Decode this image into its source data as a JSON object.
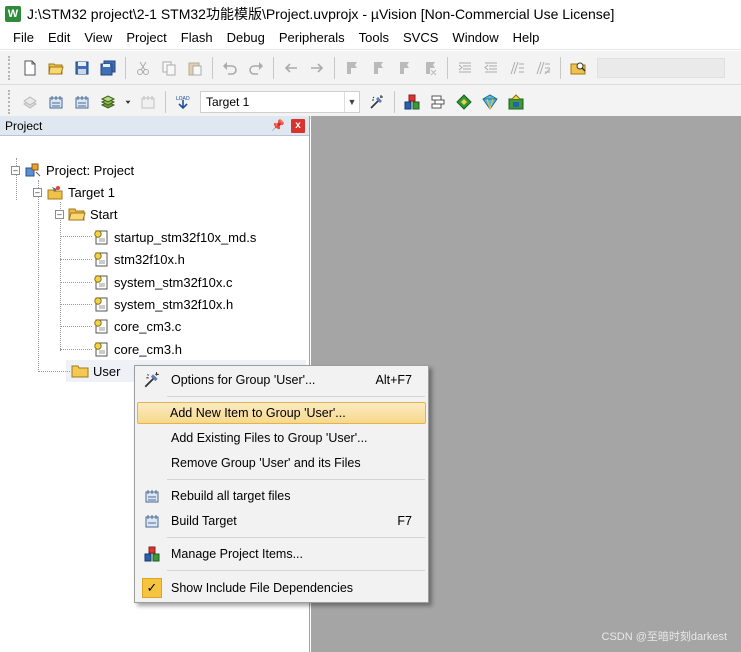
{
  "window": {
    "title": "J:\\STM32 project\\2-1 STM32功能模版\\Project.uvprojx - µVision  [Non-Commercial Use License]",
    "app_icon": "W"
  },
  "menubar": [
    "File",
    "Edit",
    "View",
    "Project",
    "Flash",
    "Debug",
    "Peripherals",
    "Tools",
    "SVCS",
    "Window",
    "Help"
  ],
  "toolbar2": {
    "target": "Target 1"
  },
  "project_panel": {
    "title": "Project",
    "pin": "q",
    "close": "x",
    "tree": {
      "root": "Project: Project",
      "target": "Target 1",
      "group_start": "Start",
      "files": [
        "startup_stm32f10x_md.s",
        "stm32f10x.h",
        "system_stm32f10x.c",
        "system_stm32f10x.h",
        "core_cm3.c",
        "core_cm3.h"
      ],
      "group_user": "User"
    }
  },
  "context_menu": {
    "options": {
      "label": "Options for Group 'User'...",
      "shortcut": "Alt+F7"
    },
    "add_new": {
      "label": "Add New  Item to Group 'User'..."
    },
    "add_existing": {
      "label": "Add Existing Files to Group 'User'..."
    },
    "remove_group": {
      "label": "Remove Group 'User' and its Files"
    },
    "rebuild": {
      "label": "Rebuild all target files"
    },
    "build": {
      "label": "Build Target",
      "shortcut": "F7"
    },
    "manage": {
      "label": "Manage Project Items..."
    },
    "show_deps": {
      "label": "Show Include File Dependencies",
      "checked": true
    }
  },
  "watermark": "CSDN @至暗时刻darkest",
  "colors": {
    "highlight": "#f7d98c",
    "editor_bg": "#a5a5a5",
    "panel_header": "#dfe7f1"
  }
}
